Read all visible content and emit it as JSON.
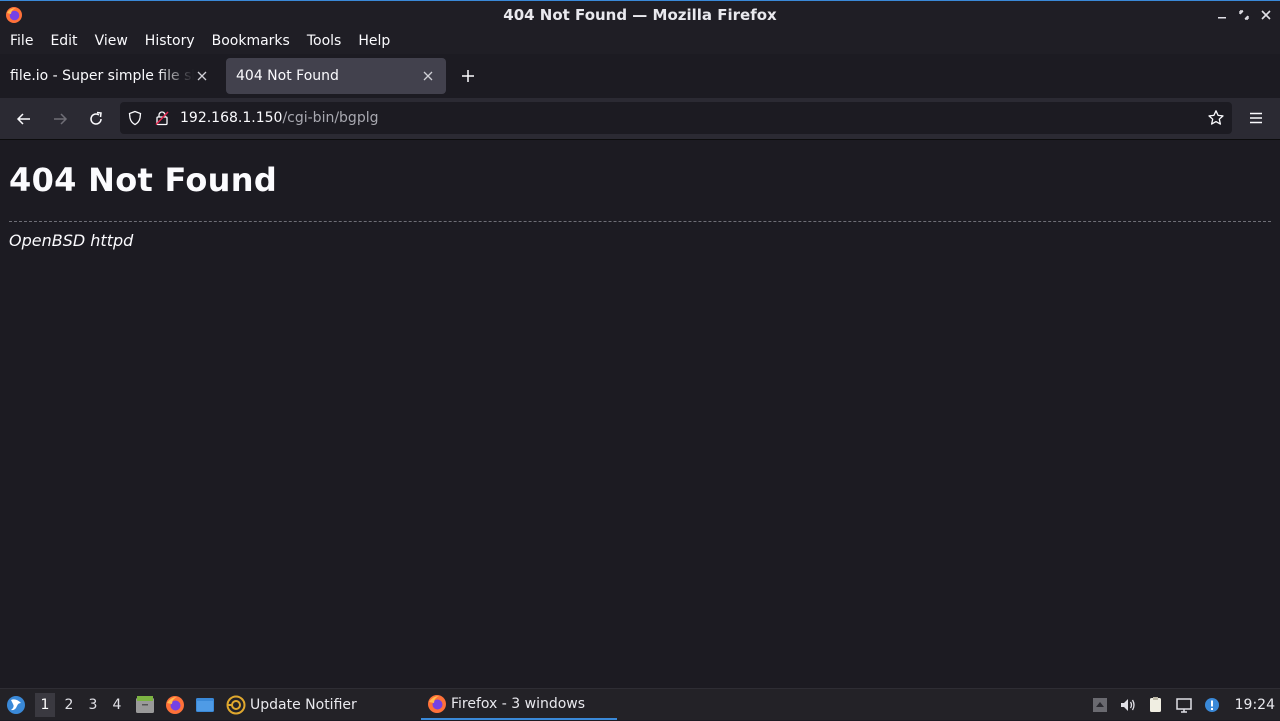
{
  "window": {
    "title": "404 Not Found — Mozilla Firefox"
  },
  "menu": [
    "File",
    "Edit",
    "View",
    "History",
    "Bookmarks",
    "Tools",
    "Help"
  ],
  "tabs": [
    {
      "label": "file.io - Super simple file sharing",
      "active": false
    },
    {
      "label": "404 Not Found",
      "active": true
    }
  ],
  "nav": {
    "url_host": "192.168.1.150",
    "url_path": "/cgi-bin/bgplg"
  },
  "page": {
    "heading": "404 Not Found",
    "server": "OpenBSD httpd"
  },
  "taskbar": {
    "workspaces": [
      "1",
      "2",
      "3",
      "4"
    ],
    "active_workspace": "1",
    "tasks": [
      {
        "label": "Update Notifier",
        "icon": "update-notifier-icon"
      },
      {
        "label": "Firefox - 3 windows",
        "icon": "firefox-icon"
      }
    ],
    "clock": "19:24"
  },
  "colors": {
    "accent": "#3a89d8",
    "page_bg": "#1c1b22",
    "toolbar_bg": "#2b2a33"
  }
}
